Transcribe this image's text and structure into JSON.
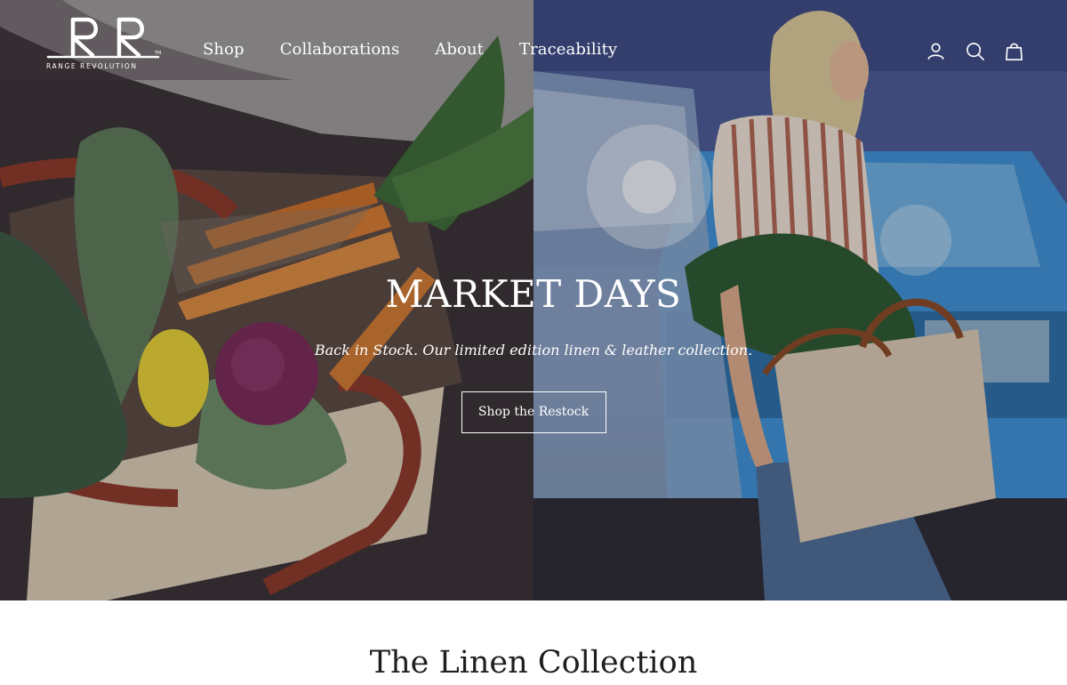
{
  "brand": {
    "name": "RANGE REVOLUTION",
    "monogram": "RR",
    "trademark": "TM"
  },
  "nav": {
    "items": [
      {
        "label": "Shop"
      },
      {
        "label": "Collaborations"
      },
      {
        "label": "About"
      },
      {
        "label": "Traceability"
      }
    ]
  },
  "header_icons": [
    "account-icon",
    "search-icon",
    "cart-icon"
  ],
  "hero": {
    "title": "MARKET DAYS",
    "subtitle": "Back in Stock. Our limited edition linen & leather collection.",
    "cta_label": "Shop the Restock"
  },
  "collection": {
    "heading": "The Linen Collection"
  },
  "colors": {
    "text_on_hero": "#ffffff",
    "heading_dark": "#1e1e1e",
    "page_background": "#ffffff"
  }
}
